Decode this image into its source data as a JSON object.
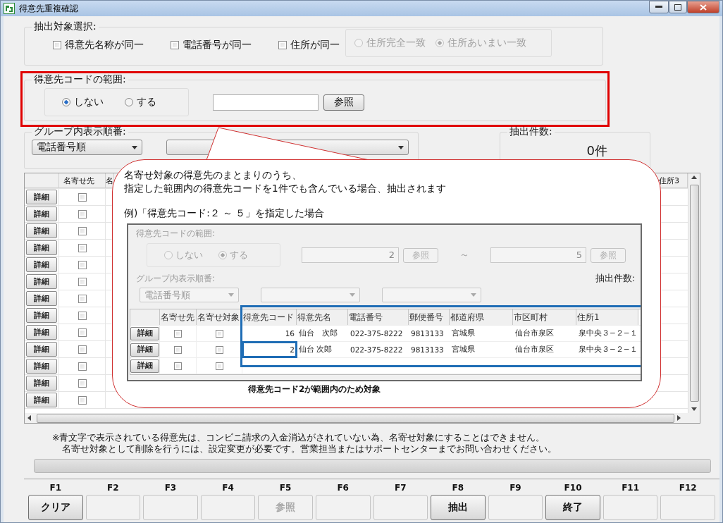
{
  "window": {
    "title": "得意先重複確認"
  },
  "extract_target": {
    "label": "抽出対象選択:",
    "checkboxes": [
      {
        "label": "得意先名称が同一",
        "checked": false
      },
      {
        "label": "電話番号が同一",
        "checked": false
      },
      {
        "label": "住所が同一",
        "checked": false
      }
    ],
    "address_match_disabled": true,
    "address_match": [
      {
        "label": "住所完全一致",
        "selected": false
      },
      {
        "label": "住所あいまい一致",
        "selected": true
      }
    ]
  },
  "code_range": {
    "label": "得意先コードの範囲:",
    "options": [
      {
        "label": "しない",
        "selected": true
      },
      {
        "label": "する",
        "selected": false
      }
    ],
    "browse_button": "参照"
  },
  "group_order": {
    "label": "グループ内表示順番:",
    "value": "電話番号順"
  },
  "count": {
    "label": "抽出件数:",
    "value": "0件"
  },
  "grid": {
    "columns": [
      "名寄せ先",
      "名",
      "住所3"
    ],
    "rows": [
      {
        "button": "詳細",
        "checked": false
      },
      {
        "button": "詳細",
        "checked": false
      },
      {
        "button": "詳細",
        "checked": false
      },
      {
        "button": "詳細",
        "checked": false
      },
      {
        "button": "詳細",
        "checked": false
      },
      {
        "button": "詳細",
        "checked": false
      },
      {
        "button": "詳細",
        "checked": false
      },
      {
        "button": "詳細",
        "checked": false
      },
      {
        "button": "詳細",
        "checked": false
      },
      {
        "button": "詳細",
        "checked": false
      },
      {
        "button": "詳細",
        "checked": false
      },
      {
        "button": "詳細",
        "checked": false
      },
      {
        "button": "詳細",
        "checked": false
      }
    ]
  },
  "callout": {
    "lines": [
      "名寄せ対象の得意先のまとまりのうち、",
      "指定した範囲内の得意先コードを1件でも含んでいる場合、抽出されます"
    ],
    "example_title": "例)「得意先コード:２ ～ ５」を指定した場合",
    "example": {
      "range_label": "得意先コードの範囲:",
      "options": [
        {
          "label": "しない",
          "selected": false
        },
        {
          "label": "する",
          "selected": true
        }
      ],
      "from": "2",
      "to": "5",
      "browse_buttons": [
        "参照",
        "参照"
      ],
      "tilde": "～",
      "order_label": "グループ内表示順番:",
      "order_value": "電話番号順",
      "count_label": "抽出件数:",
      "columns": [
        "名寄せ先",
        "名寄せ対象",
        "得意先コード",
        "得意先名",
        "電話番号",
        "郵便番号",
        "都道府県",
        "市区町村",
        "住所1"
      ],
      "rows": [
        {
          "button": "詳細",
          "merge_to": false,
          "merge_target": false,
          "highlighted": false,
          "cells": [
            "16",
            "仙台　次郎",
            "022-375-8222",
            "9813133",
            "宮城県",
            "仙台市泉区",
            "泉中央３−２−１"
          ]
        },
        {
          "button": "詳細",
          "merge_to": false,
          "merge_target": false,
          "highlighted": true,
          "cells": [
            "2",
            "仙台 次郎",
            "022-375-8222",
            "9813133",
            "宮城県",
            "仙台市泉区",
            "泉中央３−２−１"
          ]
        },
        {
          "button": "詳細",
          "merge_to": false,
          "merge_target": false,
          "highlighted": false
        }
      ]
    },
    "caption": "得意先コード2が範囲内のため対象"
  },
  "notes": [
    "※青文字で表示されている得意先は、コンビニ請求の入金消込がされていない為、名寄せ対象にすることはできません。",
    "名寄せ対象として削除を行うには、設定変更が必要です。営業担当またはサポートセンターまでお問い合わせください。"
  ],
  "progress": {
    "level": 0
  },
  "function_keys": [
    {
      "key": "F1",
      "label": "クリア",
      "disabled": false
    },
    {
      "key": "F2",
      "disabled": true
    },
    {
      "key": "F3",
      "disabled": true
    },
    {
      "key": "F4",
      "disabled": true
    },
    {
      "key": "F5",
      "label": "参照",
      "disabled": true
    },
    {
      "key": "F6",
      "disabled": true
    },
    {
      "key": "F7",
      "disabled": true
    },
    {
      "key": "F8",
      "label": "抽出",
      "disabled": false
    },
    {
      "key": "F9",
      "disabled": true
    },
    {
      "key": "F10",
      "label": "終了",
      "disabled": false
    },
    {
      "key": "F11",
      "disabled": true
    },
    {
      "key": "F12",
      "disabled": true
    }
  ]
}
